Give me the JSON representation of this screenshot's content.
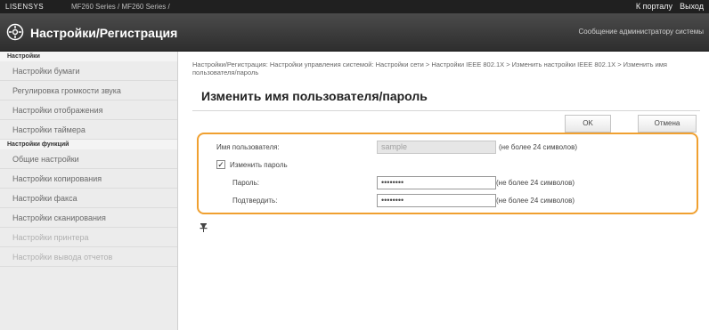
{
  "topbar": {
    "user": "LISENSYS",
    "device": "MF260 Series / MF260 Series /",
    "portal_link": "К порталу",
    "logout_link": "Выход"
  },
  "header": {
    "title": "Настройки/Регистрация",
    "admin_message": "Сообщение администратору системы"
  },
  "sidebar": {
    "section1": "Настройки",
    "items1": [
      {
        "label": "Настройки бумаги"
      },
      {
        "label": "Регулировка громкости звука"
      },
      {
        "label": "Настройки отображения"
      },
      {
        "label": "Настройки таймера"
      }
    ],
    "section2": "Настройки функций",
    "items2": [
      {
        "label": "Общие настройки"
      },
      {
        "label": "Настройки копирования"
      },
      {
        "label": "Настройки факса"
      },
      {
        "label": "Настройки сканирования"
      },
      {
        "label": "Настройки принтера"
      },
      {
        "label": "Настройки вывода отчетов"
      }
    ]
  },
  "main": {
    "breadcrumb": "Настройки/Регистрация: Настройки управления системой: Настройки сети > Настройки IEEE 802.1X > Изменить настройки IEEE 802.1X > Изменить имя пользователя/пароль",
    "title": "Изменить имя пользователя/пароль",
    "ok_label": "OK",
    "cancel_label": "Отмена"
  },
  "form": {
    "username_label": "Имя пользователя:",
    "username_value": "sample",
    "username_hint": "(не более 24 символов)",
    "change_password_label": "Изменить пароль",
    "change_password_checked": true,
    "password_label": "Пароль:",
    "password_value": "••••••••",
    "password_hint": "(не более 24 символов)",
    "confirm_label": "Подтвердить:",
    "confirm_value": "••••••••",
    "confirm_hint": "(не более 24 символов)"
  },
  "colors": {
    "highlight_border": "#f0a030",
    "header_bg": "#3a3a3a",
    "topbar_bg": "#202020"
  }
}
